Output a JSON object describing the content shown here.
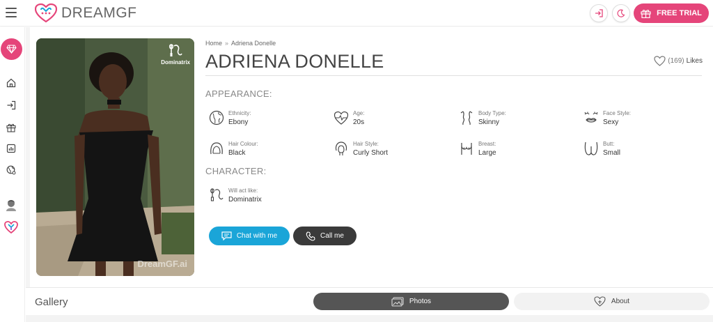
{
  "header": {
    "logo_text": "DREAMGF",
    "trial_label": "FREE TRIAL",
    "colors": {
      "accent": "#e5457a",
      "chat": "#1aa5d8",
      "dark": "#3a3a3a"
    }
  },
  "sidebar": {
    "items": [
      {
        "icon": "diamond-icon"
      },
      {
        "icon": "home-icon"
      },
      {
        "icon": "login-icon"
      },
      {
        "icon": "gift-icon"
      },
      {
        "icon": "chart-icon"
      },
      {
        "icon": "globe-icon"
      },
      {
        "icon": "avatar"
      },
      {
        "icon": "heart-badge-icon"
      }
    ]
  },
  "profile": {
    "portrait_tag": "Dominatrix",
    "watermark": "DreamGF.ai",
    "breadcrumb": {
      "home": "Home",
      "sep": "»",
      "current": "Adriena Donelle"
    },
    "name": "ADRIENA DONELLE",
    "likes": {
      "count": "(169)",
      "label": "Likes"
    }
  },
  "appearance": {
    "heading": "APPEARANCE:",
    "items": [
      {
        "label": "Ethnicity:",
        "value": "Ebony",
        "icon": "globe-face-icon"
      },
      {
        "label": "Age:",
        "value": "20s",
        "icon": "heart-pulse-icon"
      },
      {
        "label": "Body Type:",
        "value": "Skinny",
        "icon": "body-icon"
      },
      {
        "label": "Face Style:",
        "value": "Sexy",
        "icon": "lips-icon"
      },
      {
        "label": "Hair Colour:",
        "value": "Black",
        "icon": "hair-icon"
      },
      {
        "label": "Hair Style:",
        "value": "Curly Short",
        "icon": "hairstyle-icon"
      },
      {
        "label": "Breast:",
        "value": "Large",
        "icon": "breast-icon"
      },
      {
        "label": "Butt:",
        "value": "Small",
        "icon": "butt-icon"
      }
    ]
  },
  "character": {
    "heading": "CHARACTER:",
    "items": [
      {
        "label": "Will act like:",
        "value": "Dominatrix",
        "icon": "whip-icon"
      }
    ]
  },
  "actions": {
    "chat_label": "Chat with me",
    "call_label": "Call me"
  },
  "gallery": {
    "title": "Gallery",
    "tab_photos": "Photos",
    "tab_about": "About"
  }
}
